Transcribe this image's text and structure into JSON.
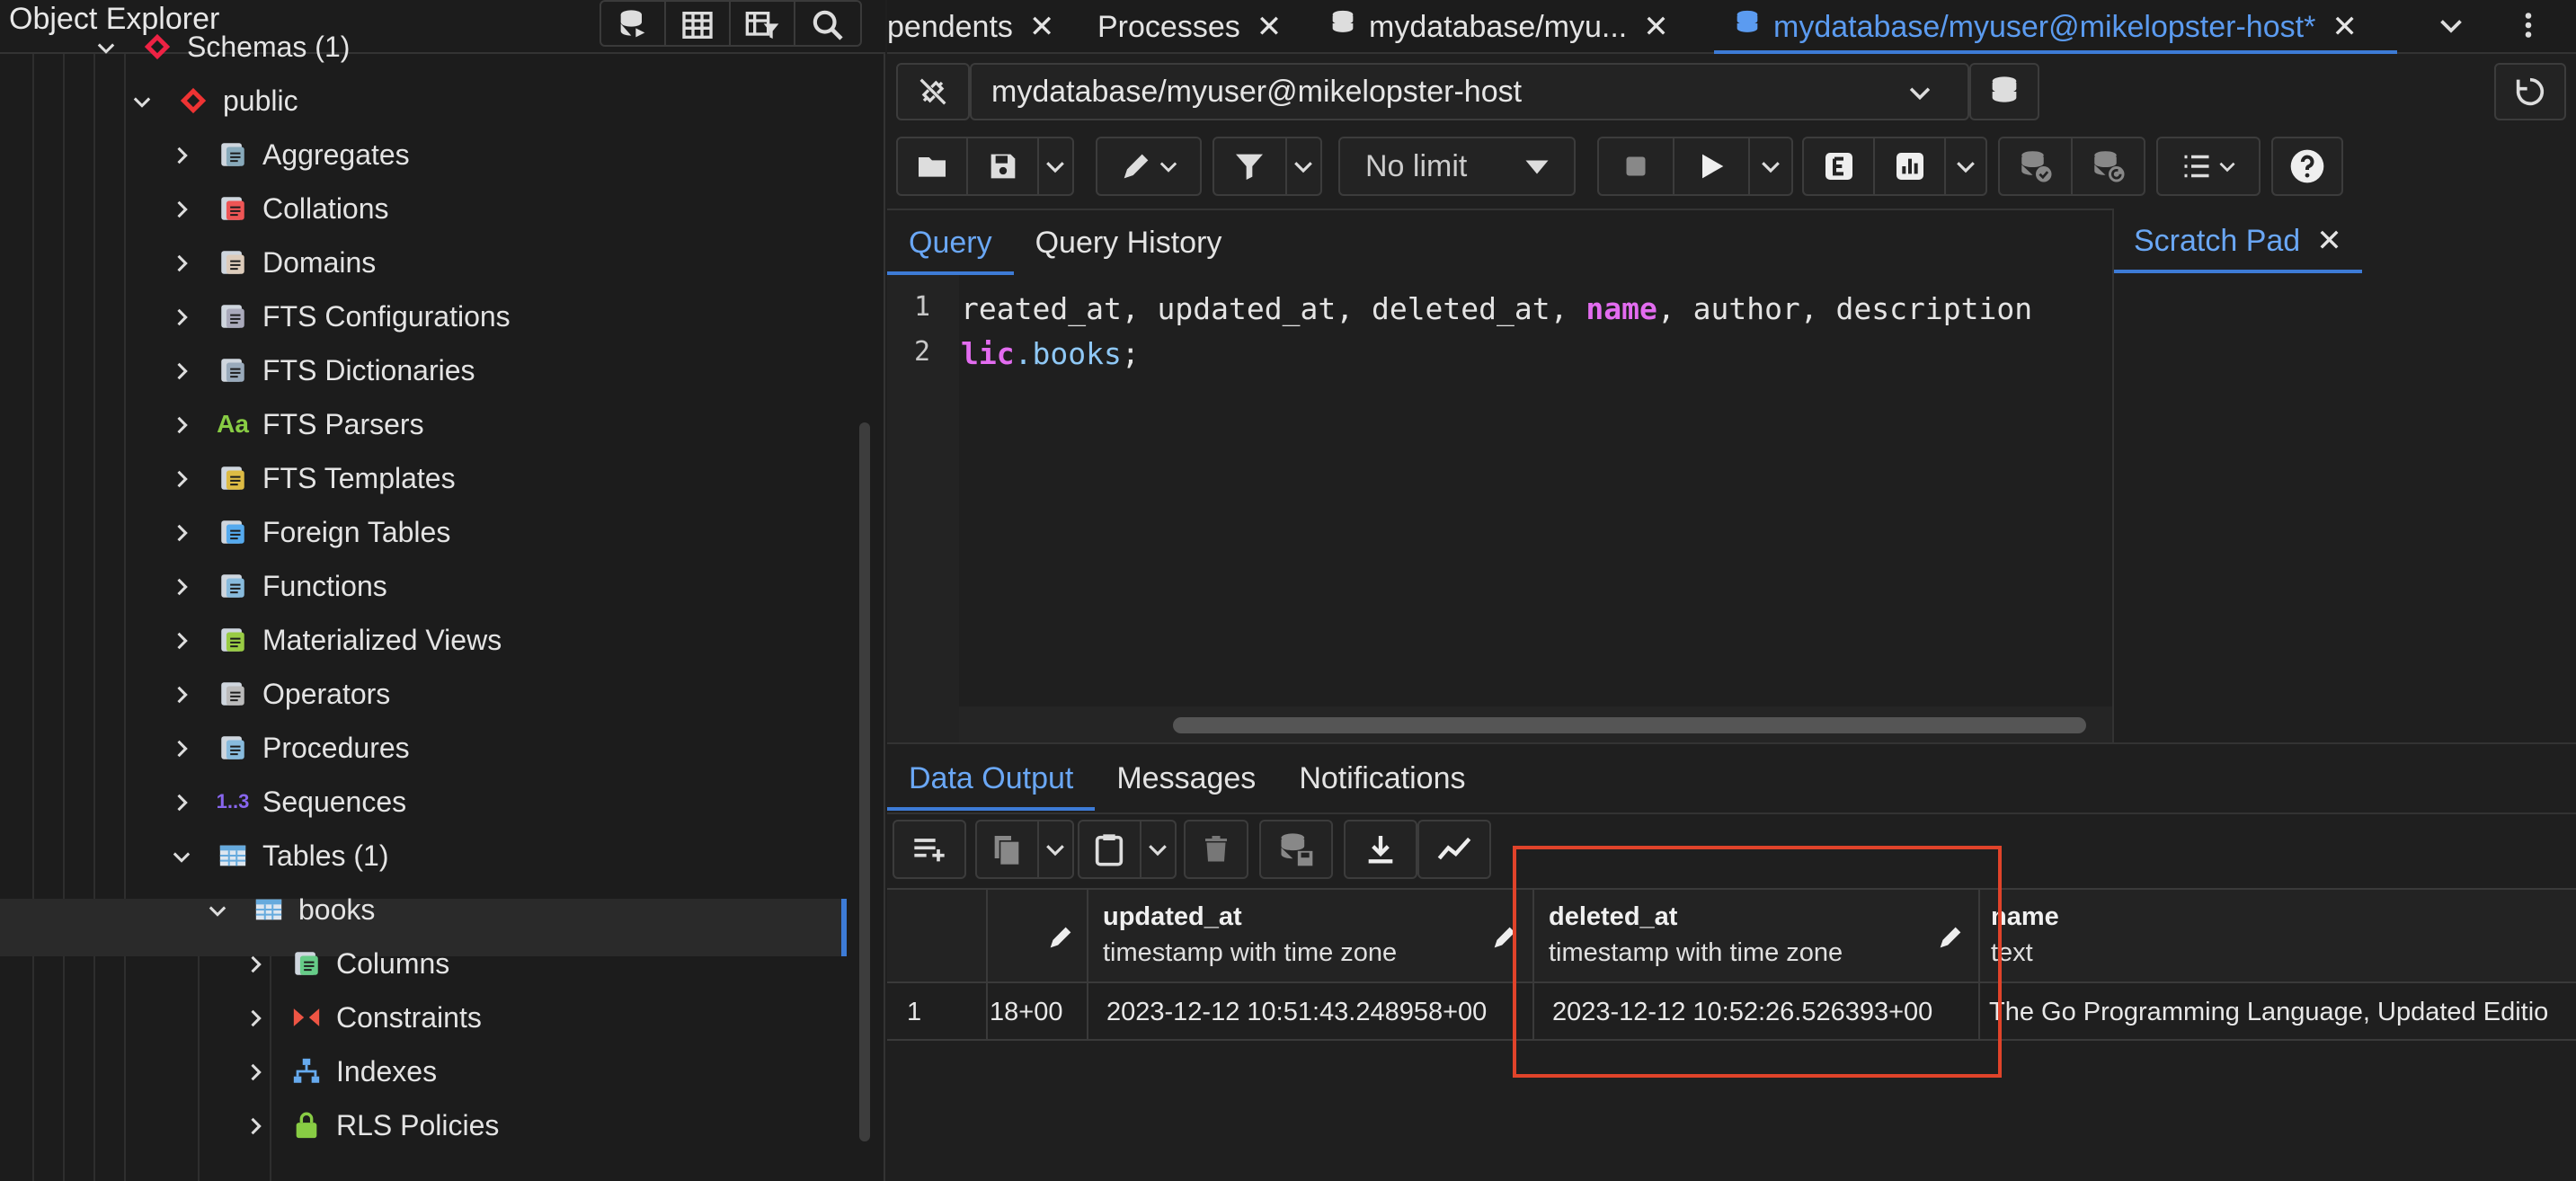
{
  "object_explorer": {
    "title": "Object Explorer",
    "toolbar": [
      "query-tool-icon",
      "view-data-icon",
      "filtered-rows-icon",
      "search-icon"
    ],
    "tree": [
      {
        "label": "Schemas (1)",
        "icon": "schemas-icon",
        "expanded": true
      },
      {
        "label": "public",
        "icon": "schema-icon",
        "expanded": true
      },
      {
        "label": "Aggregates",
        "icon": "aggregates-icon",
        "expanded": false
      },
      {
        "label": "Collations",
        "icon": "collations-icon",
        "expanded": false
      },
      {
        "label": "Domains",
        "icon": "domains-icon",
        "expanded": false
      },
      {
        "label": "FTS Configurations",
        "icon": "fts-config-icon",
        "expanded": false
      },
      {
        "label": "FTS Dictionaries",
        "icon": "fts-dictionaries-icon",
        "expanded": false
      },
      {
        "label": "FTS Parsers",
        "icon": "fts-parsers-icon",
        "icon_text": "Aa",
        "expanded": false
      },
      {
        "label": "FTS Templates",
        "icon": "fts-templates-icon",
        "expanded": false
      },
      {
        "label": "Foreign Tables",
        "icon": "foreign-tables-icon",
        "expanded": false
      },
      {
        "label": "Functions",
        "icon": "functions-icon",
        "expanded": false
      },
      {
        "label": "Materialized Views",
        "icon": "materialized-views-icon",
        "expanded": false
      },
      {
        "label": "Operators",
        "icon": "operators-icon",
        "expanded": false
      },
      {
        "label": "Procedures",
        "icon": "procedures-icon",
        "expanded": false
      },
      {
        "label": "Sequences",
        "icon": "sequences-icon",
        "icon_text": "1..3",
        "expanded": false
      },
      {
        "label": "Tables (1)",
        "icon": "tables-icon",
        "expanded": true
      },
      {
        "label": "books",
        "icon": "table-icon",
        "expanded": true,
        "selected": true
      },
      {
        "label": "Columns",
        "icon": "columns-icon",
        "expanded": false
      },
      {
        "label": "Constraints",
        "icon": "constraints-icon",
        "expanded": false
      },
      {
        "label": "Indexes",
        "icon": "indexes-icon",
        "expanded": false
      },
      {
        "label": "RLS Policies",
        "icon": "rls-policies-icon",
        "expanded": false
      }
    ]
  },
  "tabs": [
    {
      "label": "pendents",
      "closable": true,
      "active": false
    },
    {
      "label": "Processes",
      "closable": true,
      "active": false
    },
    {
      "label": "mydatabase/myu...",
      "closable": true,
      "active": false
    },
    {
      "label": "mydatabase/myuser@mikelopster-host*",
      "closable": true,
      "active": true
    }
  ],
  "connection": {
    "value": "mydatabase/myuser@mikelopster-host"
  },
  "toolbar": {
    "limit": "No limit"
  },
  "query_tabs": {
    "query": "Query",
    "history": "Query History",
    "scratch": "Scratch Pad"
  },
  "editor": {
    "lines": [
      {
        "number": "1",
        "parts": [
          {
            "t": "reated_at, updated_at, deleted_at, ",
            "c": "plain"
          },
          {
            "t": "name",
            "c": "kw"
          },
          {
            "t": ", author, description",
            "c": "plain"
          }
        ]
      },
      {
        "number": "2",
        "parts": [
          {
            "t": "lic",
            "c": "kw"
          },
          {
            "t": ".books",
            "c": "tbl"
          },
          {
            "t": ";",
            "c": "plain"
          }
        ]
      }
    ]
  },
  "output_tabs": {
    "data": "Data Output",
    "messages": "Messages",
    "notifications": "Notifications"
  },
  "grid": {
    "columns": [
      {
        "name": "",
        "type": ""
      },
      {
        "name": "updated_at",
        "type": "timestamp with time zone"
      },
      {
        "name": "deleted_at",
        "type": "timestamp with time zone"
      },
      {
        "name": "name",
        "type": "text"
      }
    ],
    "rows": [
      {
        "row": "1",
        "cells": [
          "18+00",
          "2023-12-12 10:51:43.248958+00",
          "2023-12-12 10:52:26.526393+00",
          "The Go Programming Language, Updated Editio"
        ]
      }
    ]
  },
  "colors": {
    "accent": "#3d7bd6",
    "highlight": "#e0432a",
    "keyword": "#e36cf0"
  }
}
